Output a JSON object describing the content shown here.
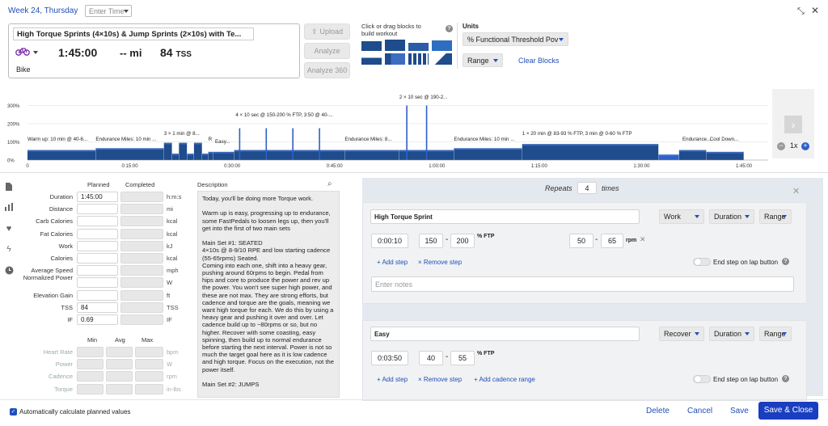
{
  "top": {
    "date_link": "Week 24, Thursday",
    "time_placeholder": "Enter Time"
  },
  "workout": {
    "title": "High Torque Sprints (4×10s) & Jump Sprints (2×10s) with Te...",
    "duration": "1:45:00",
    "distance": "-- mi",
    "tss_value": "84",
    "tss_unit": "TSS",
    "sport": "Bike"
  },
  "actions": {
    "upload": "Upload",
    "analyze": "Analyze",
    "analyze360": "Analyze 360"
  },
  "blocks": {
    "hint": "Click or drag blocks to build workout"
  },
  "units": {
    "label": "Units",
    "selected": "% Functional Threshold Pov",
    "range": "Range",
    "clear": "Clear Blocks"
  },
  "graph": {
    "yticks": [
      "300%",
      "200%",
      "100%",
      "0%"
    ],
    "xticks": [
      "0",
      "0:15:00",
      "0:30:00",
      "0:45:00",
      "1:00:00",
      "1:15:00",
      "1:30:00",
      "1:45:00"
    ],
    "labels": [
      {
        "text": "Warm up: 10 min @ 40-6...",
        "minute": 0,
        "level": "low"
      },
      {
        "text": "Endurance Miles: 10 min ...",
        "minute": 10,
        "level": "low"
      },
      {
        "text": "3 × 1 min @ 8...",
        "minute": 20,
        "level": "mid"
      },
      {
        "text": "R",
        "minute": 26.5,
        "level": "low"
      },
      {
        "text": "Easy...",
        "minute": 27.5,
        "level": "low2"
      },
      {
        "text": "4 × 10 sec @ 150-200 % FTP, 3:50 @ 40-...",
        "minute": 30.5,
        "level": "high"
      },
      {
        "text": "Endurance Miles: 8...",
        "minute": 46.5,
        "level": "low"
      },
      {
        "text": "2 × 10 sec @ 190-2...",
        "minute": 54.5,
        "level": "top"
      },
      {
        "text": "Endurance Miles: 10 min ...",
        "minute": 62.5,
        "level": "low"
      },
      {
        "text": "1 × 20 min @ 83-93 % FTP, 3 min @ 0-60 % FTP",
        "minute": 72.5,
        "level": "mid"
      },
      {
        "text": "Endurance...",
        "minute": 96,
        "level": "low"
      },
      {
        "text": "Cool Down...",
        "minute": 100,
        "level": "low"
      }
    ],
    "zoom": "1x"
  },
  "sidebar_icons": [
    "document-icon",
    "chart-icon",
    "heart-icon",
    "bolt-icon",
    "clock-icon"
  ],
  "metrics": {
    "col_planned": "Planned",
    "col_completed": "Completed",
    "rows": [
      {
        "label": "Duration",
        "planned": "1:45:00",
        "unit": "h:m:s"
      },
      {
        "label": "Distance",
        "planned": "",
        "unit": "mi"
      },
      {
        "label": "Carb Calories",
        "planned": "",
        "unit": "kcal"
      },
      {
        "label": "Fat Calories",
        "planned": "",
        "unit": "kcal"
      },
      {
        "label": "Work",
        "planned": "",
        "unit": "kJ"
      },
      {
        "label": "Calories",
        "planned": "",
        "unit": "kcal"
      },
      {
        "label": "Average Speed",
        "planned": "",
        "unit": "mph"
      },
      {
        "label": "Normalized Power",
        "planned": "",
        "unit": "W"
      },
      {
        "label": "Elevation Gain",
        "planned": "",
        "unit": "ft"
      },
      {
        "label": "TSS",
        "planned": "84",
        "unit": "TSS"
      },
      {
        "label": "IF",
        "planned": "0.69",
        "unit": "IF"
      }
    ],
    "col_min": "Min",
    "col_avg": "Avg",
    "col_max": "Max",
    "rows2": [
      {
        "label": "Heart Rate",
        "unit": "bpm"
      },
      {
        "label": "Power",
        "unit": "W"
      },
      {
        "label": "Cadence",
        "unit": "rpm"
      },
      {
        "label": "Torque",
        "unit": "in-lbs"
      }
    ]
  },
  "description": {
    "header": "Description",
    "text": "Today, you'll be doing more Torque work.\n\nWarm up is easy, progressing up to endurance, some FastPedals to loosen legs up, then you'll get into the first of two main sets\n\nMain Set #1: SEATED\n4×10s @ 8-9/10 RPE and low starting cadence (55-65rpms) Seated.\nComing into each one, shift into a heavy gear, pushing around 60rpms to begin. Pedal from hips and core to produce the power and rev up the power. You won't see super high power, and these are not max. They are strong efforts, but cadence and torque are the goals, meaning we want high torque for each. We do this by using a heavy gear and pushing it over and over. Let cadence build up to ~80rpms or so, but no higher. Recover with some coasting, easy spinning, then build up to normal endurance before starting the next interval. Power is not so much the target goal here as it is low cadence and high torque. Focus on the execution, not the power itself.\n\nMain Set #2: JUMPS"
  },
  "repeats": {
    "label_pre": "Repeats",
    "count": "4",
    "label_post": "times"
  },
  "steps": [
    {
      "name": "High Torque Sprint",
      "type": "Work",
      "mode": "Duration",
      "range": "Range",
      "duration": "0:00:10",
      "low": "150",
      "high": "200",
      "unit": "% FTP",
      "cad_low": "50",
      "cad_high": "65",
      "cad_unit": "rpm",
      "add": "+ Add step",
      "remove": "× Remove step",
      "lap": "End step on lap button",
      "notes_placeholder": "Enter notes"
    },
    {
      "name": "Easy",
      "type": "Recover",
      "mode": "Duration",
      "range": "Range",
      "duration": "0:03:50",
      "low": "40",
      "high": "55",
      "unit": "% FTP",
      "add": "+ Add step",
      "remove": "× Remove step",
      "add_cad": "+ Add cadence range",
      "lap": "End step on lap button"
    }
  ],
  "footer": {
    "auto_calc": "Automatically calculate planned values",
    "delete": "Delete",
    "cancel": "Cancel",
    "save": "Save",
    "save_close": "Save & Close"
  },
  "colors": {
    "accent": "#1f4fb8",
    "bar": "#1e4c8c",
    "bar_hi": "#2f5fc8",
    "save": "#1a3ec0"
  }
}
